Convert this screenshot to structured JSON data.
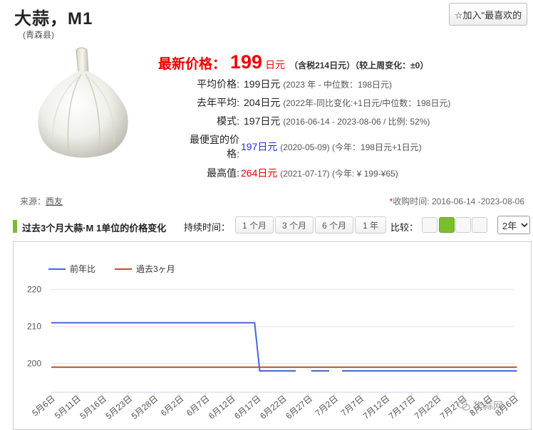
{
  "header": {
    "title": "大蒜，M1",
    "region": "(青森县)",
    "favorite_button": "☆加入\"最喜欢的"
  },
  "latest": {
    "label": "最新价格：",
    "value": "199",
    "unit": "日元",
    "note": "（含税214日元）（较上周变化：±0）"
  },
  "stats": [
    {
      "label": "平均价格:",
      "value": "199",
      "unit": "日元",
      "detail": "(2023 年 - 中位数：198日元)"
    },
    {
      "label": "去年平均:",
      "value": "204",
      "unit": "日元",
      "detail_pre": "(2022年-同比变化:",
      "detail_red": "+1日元",
      "detail_post": "/中位数：198日元)"
    },
    {
      "label": "模式:",
      "value": "197",
      "unit": "日元",
      "detail": "(2016-06-14 - 2023-08-06 / 比例: 52%)"
    },
    {
      "label_line1": "最便宜的价",
      "label_line2": "格:",
      "value": "197",
      "unit": "日元",
      "detail_pre": "(2020-05-09) (今年：198日元",
      "detail_red": "+1日元",
      "detail_post": ")"
    },
    {
      "label": "最高值:",
      "value": "264",
      "unit": "日元",
      "detail_pre": "(2021-07-17) (今年: ¥ 199-",
      "detail_blue": "¥65",
      "detail_post": ")"
    }
  ],
  "source": {
    "label": "来源：",
    "link": "西友"
  },
  "period": {
    "star": "*",
    "text": "收购时间: 2016-06-14 -2023-08-06"
  },
  "chart_controls": {
    "title": "过去3个月大蒜·M 1单位的价格变化",
    "duration_label": "持续时间：",
    "buttons": [
      "1 个月",
      "3 个月",
      "6 个月",
      "1 年"
    ],
    "compare_label": "比较：",
    "year_select": "2年"
  },
  "colors": {
    "accent": "#7cbd2a",
    "series_yoy": "#4466dd",
    "series_3m": "#c0502a",
    "price_red": "#e00000"
  },
  "chart_data": {
    "type": "line",
    "x": [
      "5月6日",
      "5月11日",
      "5月16日",
      "5月23日",
      "5月28日",
      "6月2日",
      "6月7日",
      "6月12日",
      "6月17日",
      "6月22日",
      "6月27日",
      "7月2日",
      "7月7日",
      "7月12日",
      "7月17日",
      "7月22日",
      "7月27日",
      "8月1日",
      "8月6日"
    ],
    "yticks": [
      200,
      210,
      220
    ],
    "ylim": [
      193,
      223
    ],
    "grid": true,
    "legend": "top-left",
    "series": [
      {
        "name": "前年比",
        "color": "#4466dd",
        "segments": [
          [
            [
              0,
              211
            ],
            [
              7.9,
              211
            ],
            [
              8.1,
              198
            ],
            [
              9.5,
              198
            ]
          ],
          [
            [
              10.1,
              198
            ],
            [
              10.8,
              198
            ]
          ],
          [
            [
              11.3,
              198
            ],
            [
              18.1,
              198
            ]
          ]
        ]
      },
      {
        "name": "過去3ヶ月",
        "color": "#c0502a",
        "segments": [
          [
            [
              0,
              199
            ],
            [
              18.1,
              199
            ]
          ]
        ]
      }
    ]
  },
  "watermark": "华蒜网"
}
